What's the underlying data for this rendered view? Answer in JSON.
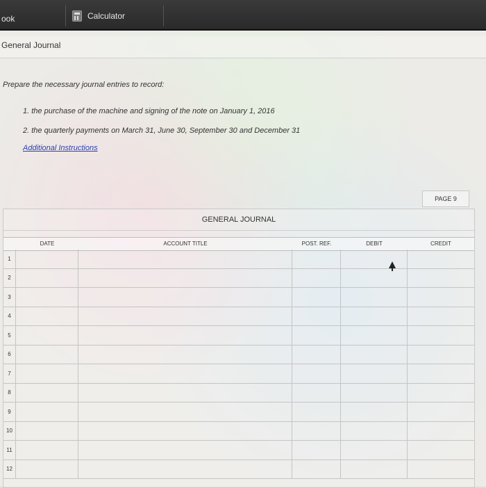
{
  "tabs": {
    "ebook": "ook",
    "calculator": "Calculator"
  },
  "section": {
    "title": "General Journal"
  },
  "instructions": {
    "prompt": "Prepare the necessary journal entries to record:",
    "items": [
      "1. the purchase of the machine and signing of the note on January 1, 2016",
      "2. the quarterly payments on March 31, June 30, September 30 and December 31"
    ],
    "link": "Additional Instructions"
  },
  "journal": {
    "page": "PAGE 9",
    "title": "GENERAL JOURNAL",
    "headers": {
      "date": "DATE",
      "account": "ACCOUNT TITLE",
      "ref": "POST. REF.",
      "debit": "DEBIT",
      "credit": "CREDIT"
    },
    "row_numbers": [
      "1",
      "2",
      "3",
      "4",
      "5",
      "6",
      "7",
      "8",
      "9",
      "10",
      "11",
      "12"
    ]
  },
  "icons": {
    "calculator": "calculator-icon",
    "cursor": "mouse-pointer-icon"
  }
}
